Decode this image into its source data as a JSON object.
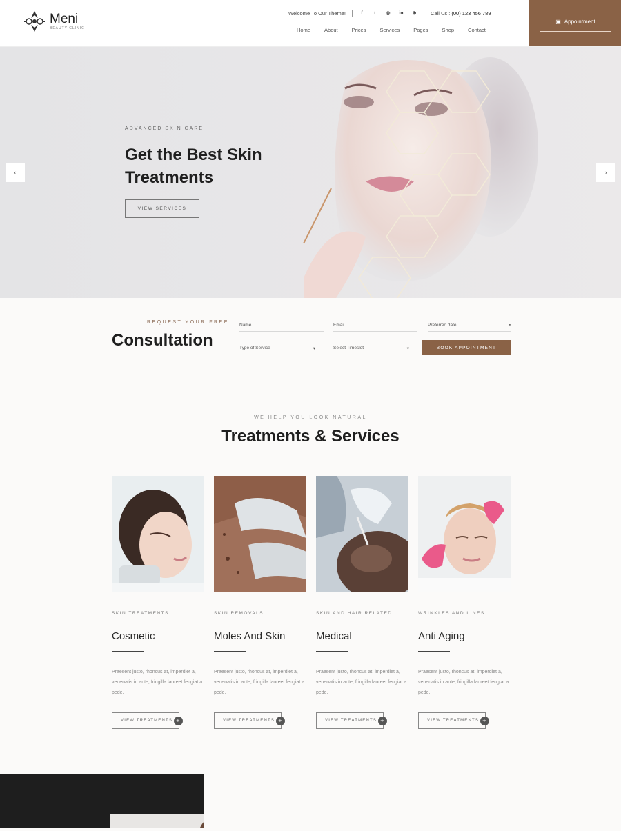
{
  "header": {
    "logo_name": "Meni",
    "logo_tagline": "BEAUTY CLINIC",
    "welcome": "Welcome To Our Theme!",
    "social_icons": [
      "facebook-icon",
      "twitter-icon",
      "instagram-icon",
      "linkedin-icon",
      "dribbble-icon"
    ],
    "call_label": "Call Us :",
    "phone": "(00) 123 456 789",
    "nav": [
      "Home",
      "About",
      "Prices",
      "Services",
      "Pages",
      "Shop",
      "Contact"
    ],
    "appointment_label": "Appointment"
  },
  "hero": {
    "kicker": "ADVANCED SKIN CARE",
    "title": "Get the Best Skin Treatments",
    "button": "VIEW SERVICES",
    "prev": "‹",
    "next": "›"
  },
  "consultation": {
    "kicker": "REQUEST YOUR FREE",
    "title": "Consultation",
    "name_placeholder": "Name",
    "email_placeholder": "Email",
    "date_placeholder": "Preferred date",
    "service_placeholder": "Type of Service",
    "time_placeholder": "Select Timeslot",
    "book_button": "BOOK APPOINTMENT"
  },
  "services": {
    "kicker": "WE HELP YOU LOOK NATURAL",
    "title": "Treatments & Services",
    "cards": [
      {
        "category": "SKIN TREATMENTS",
        "title": "Cosmetic",
        "desc": "Praesent justo, rhoncus at, imperdiet a, venenatis in ante, fringilla laoreet feugiat a pede.",
        "button": "VIEW TREATMENTS"
      },
      {
        "category": "SKIN REMOVALS",
        "title": "Moles And Skin",
        "desc": "Praesent justo, rhoncus at, imperdiet a, venenatis in ante, fringilla laoreet feugiat a pede.",
        "button": "VIEW TREATMENTS"
      },
      {
        "category": "SKIN AND HAIR RELATED",
        "title": "Medical",
        "desc": "Praesent justo, rhoncus at, imperdiet a, venenatis in ante, fringilla laoreet feugiat a pede.",
        "button": "VIEW TREATMENTS"
      },
      {
        "category": "WRINKLES AND LINES",
        "title": "Anti Aging",
        "desc": "Praesent justo, rhoncus at, imperdiet a, venenatis in ante, fringilla laoreet feugiat a pede.",
        "button": "VIEW TREATMENTS"
      }
    ]
  },
  "colors": {
    "accent": "#8a6246",
    "background": "#fbfaf9",
    "hero_bg": "#e6e5e7"
  }
}
